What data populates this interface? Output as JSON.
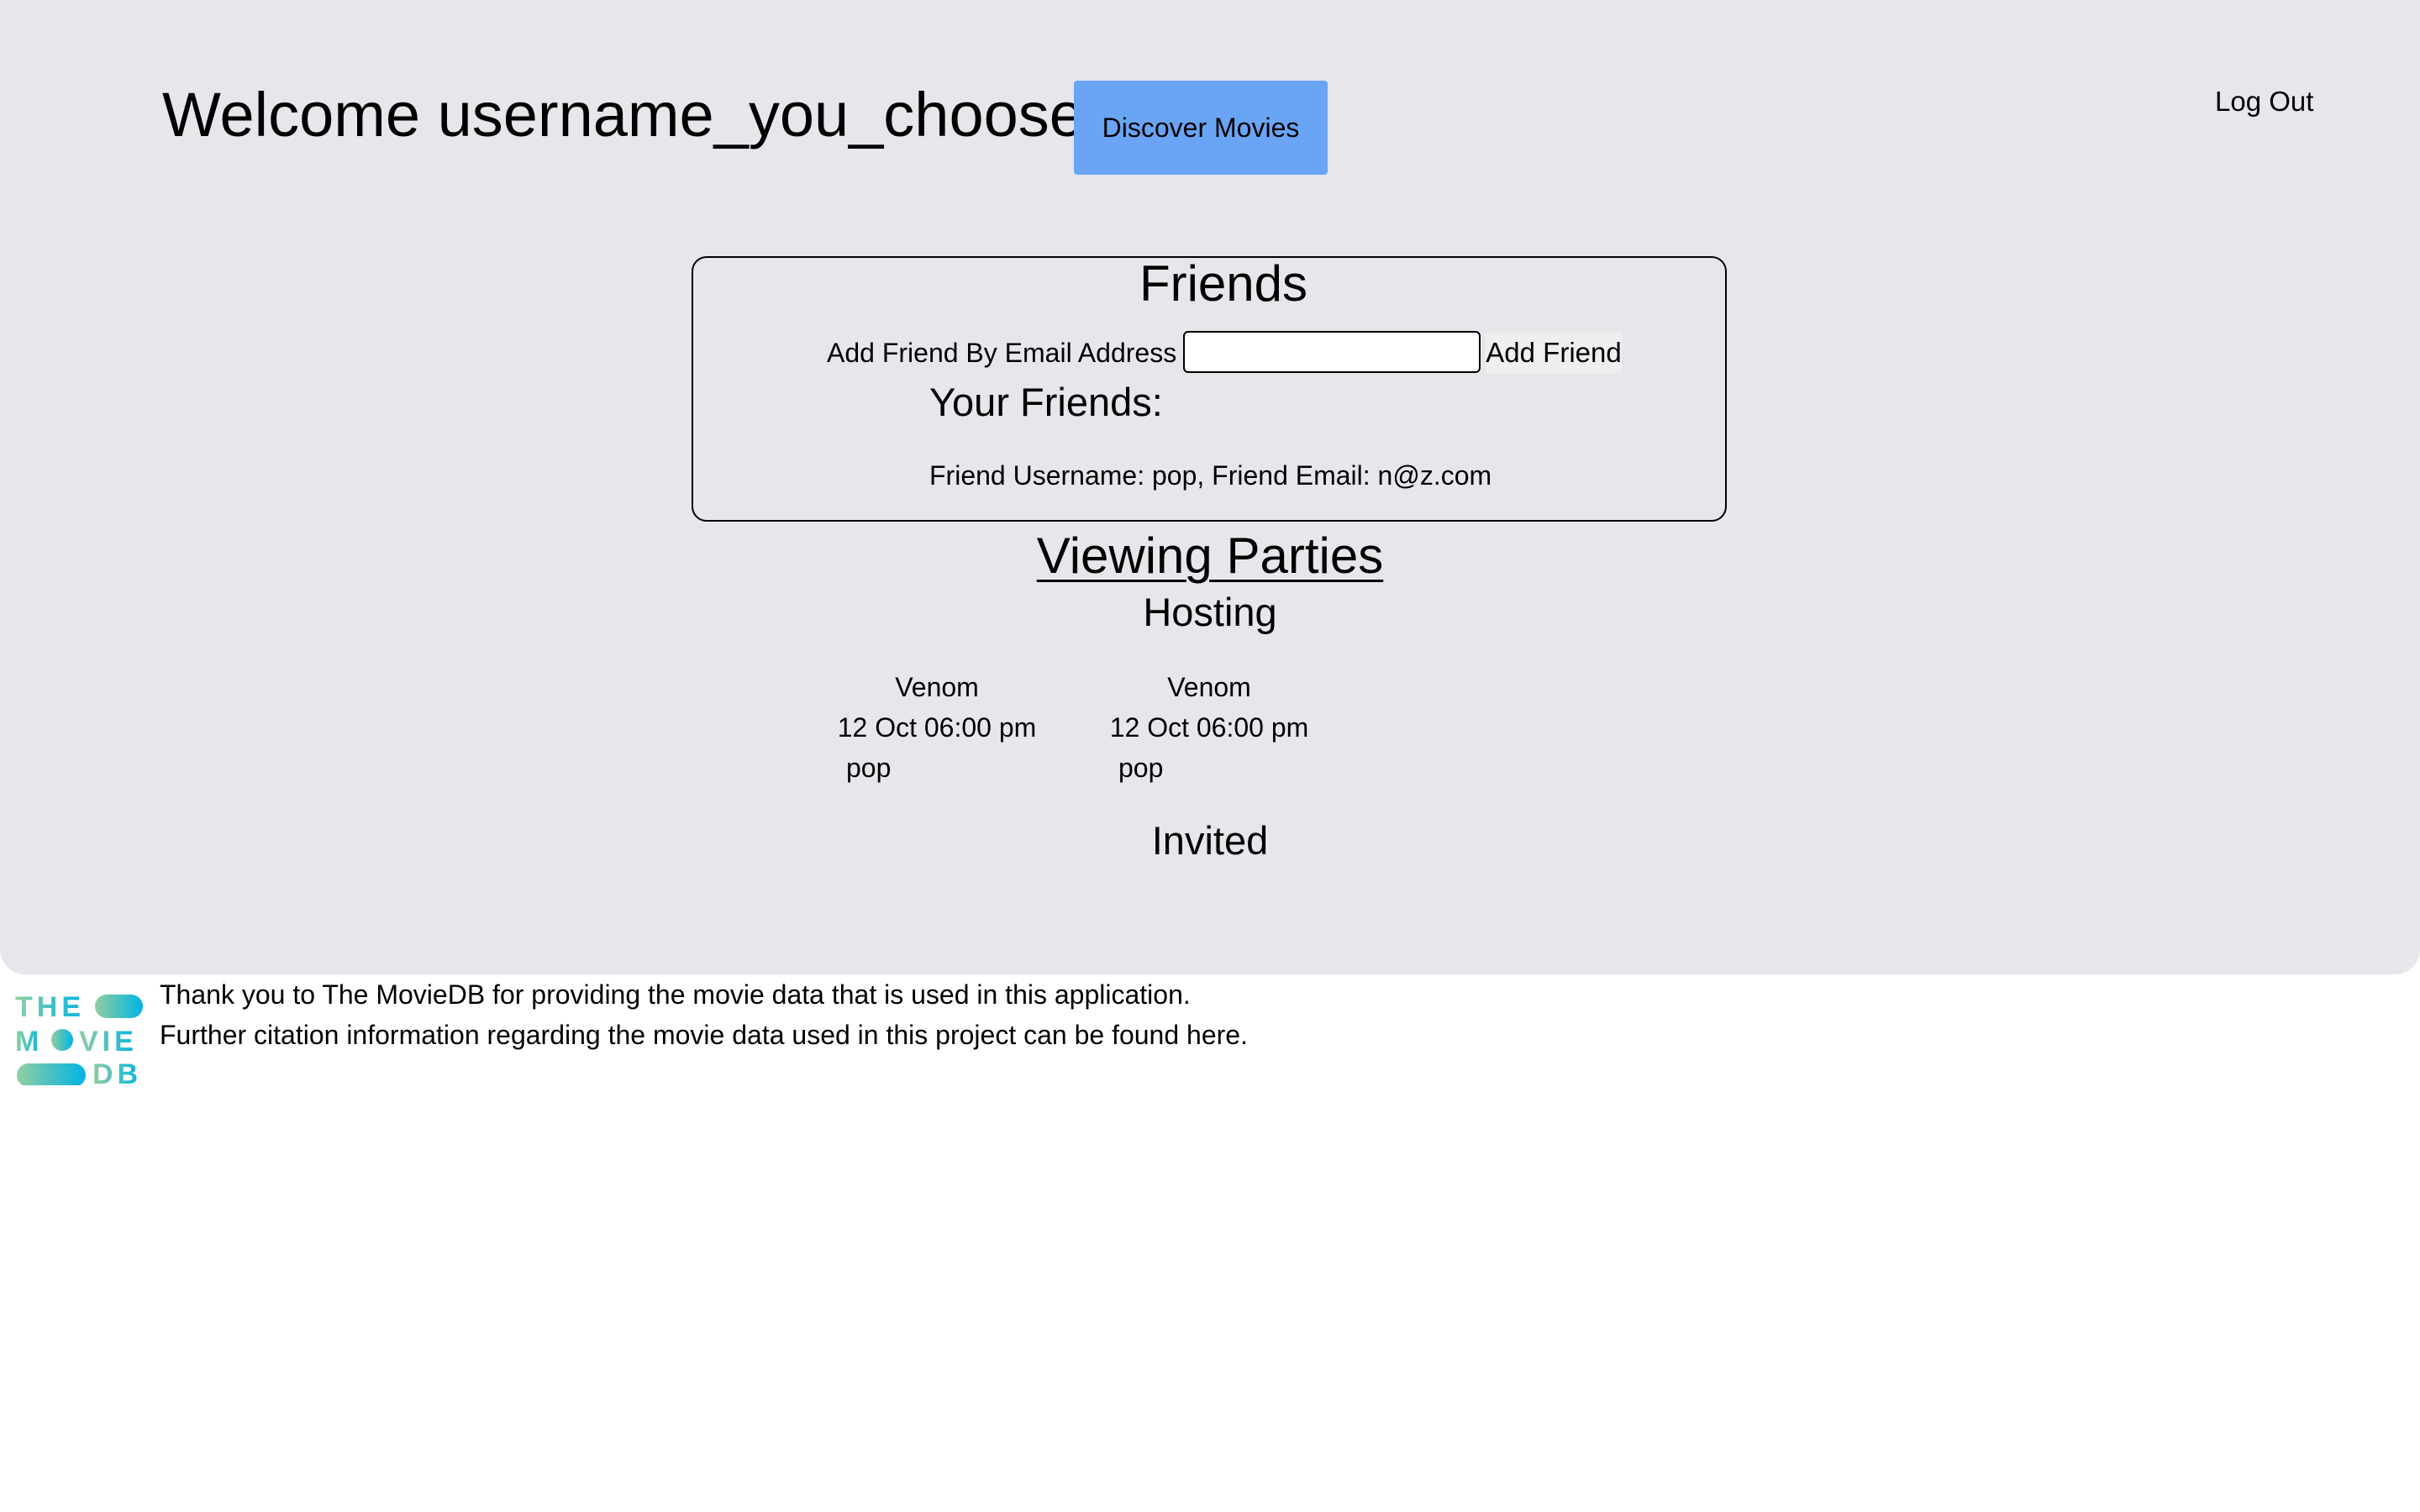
{
  "header": {
    "welcome": "Welcome username_you_choose",
    "discover_button": "Discover Movies",
    "logout_link": "Log Out"
  },
  "friends": {
    "title": "Friends",
    "add_label": "Add Friend By Email Address",
    "add_input_value": "",
    "add_button": "Add Friend",
    "list_heading": "Your Friends:",
    "list": [
      "Friend Username: pop, Friend Email: n@z.com"
    ]
  },
  "viewing_parties": {
    "title": "Viewing Parties",
    "hosting_heading": "Hosting",
    "hosting": [
      {
        "movie": "Venom",
        "datetime": "12 Oct 06:00 pm",
        "host": "pop"
      },
      {
        "movie": "Venom",
        "datetime": "12 Oct 06:00 pm",
        "host": "pop"
      }
    ],
    "invited_heading": "Invited"
  },
  "footer": {
    "logo": {
      "icon": "tmdb-logo-icon",
      "row1": "THE",
      "row2_left": "M",
      "row2_right": "VIE",
      "row3": "DB",
      "gradient_start": "#90cea1",
      "gradient_end": "#01b4e4"
    },
    "credit_line_1": "Thank you to The MovieDB for providing the movie data that is used in this application.",
    "credit_line_2": "Further citation information regarding the movie data used in this project can be found here."
  },
  "colors": {
    "panel_background": "#e5e7eb",
    "discover_button": "#6aa4f4",
    "add_friend_button": "#efefef"
  }
}
